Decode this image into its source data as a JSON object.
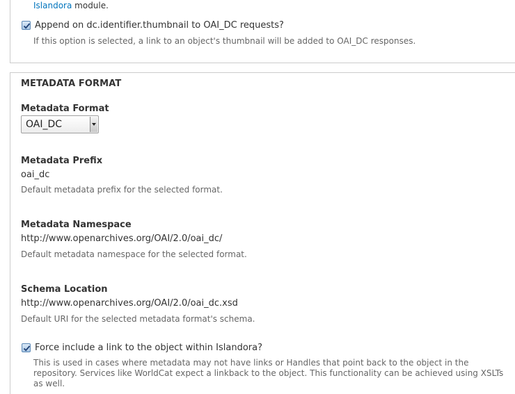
{
  "thumbnail_section": {
    "partial_text_suffix": " module.",
    "islandora_link": "Islandora",
    "checkbox_label": "Append on dc.identifier.thumbnail to OAI_DC requests?",
    "checkbox_checked": true,
    "description": "If this option is selected, a link to an object's thumbnail will be added to OAI_DC responses."
  },
  "metadata_format_section": {
    "legend": "METADATA FORMAT",
    "format_label": "Metadata Format",
    "format_selected": "OAI_DC",
    "prefix_label": "Metadata Prefix",
    "prefix_value": "oai_dc",
    "prefix_description": "Default metadata prefix for the selected format.",
    "namespace_label": "Metadata Namespace",
    "namespace_value": "http://www.openarchives.org/OAI/2.0/oai_dc/",
    "namespace_description": "Default metadata namespace for the selected format.",
    "schema_label": "Schema Location",
    "schema_value": "http://www.openarchives.org/OAI/2.0/oai_dc.xsd",
    "schema_description": "Default URI for the selected metadata format's schema.",
    "force_link_label": "Force include a link to the object within Islandora?",
    "force_link_checked": true,
    "force_link_description": "This is used in cases where metadata may not have links or Handles that point back to the object in the repository. Services like WorldCat expect a linkback to the object. This functionality can be achieved using XSLTs as well."
  },
  "colors": {
    "link": "#0074bd",
    "border": "#cccccc",
    "text": "#333333",
    "description": "#666666"
  }
}
